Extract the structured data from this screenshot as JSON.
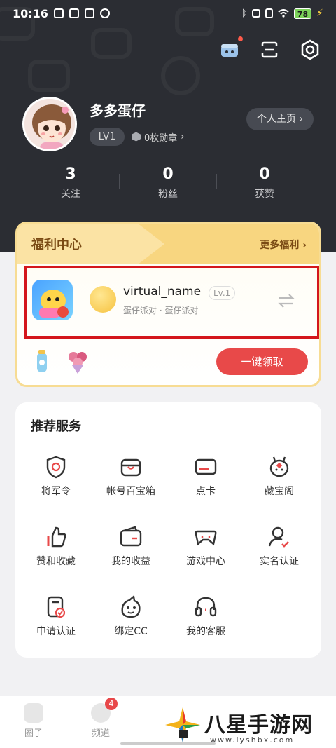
{
  "status_bar": {
    "time": "10:16",
    "battery": "78"
  },
  "profile": {
    "name": "多多蛋仔",
    "level": "LV1",
    "badges": "0枚勋章",
    "home_button": "个人主页"
  },
  "stats": [
    {
      "value": "3",
      "label": "关注"
    },
    {
      "value": "0",
      "label": "粉丝"
    },
    {
      "value": "0",
      "label": "获赞"
    }
  ],
  "welfare": {
    "title": "福利中心",
    "more": "更多福利",
    "account_name": "virtual_name",
    "account_level": "Lv.1",
    "account_sub": "蛋仔派对 · 蛋仔派对",
    "claim_button": "一键领取"
  },
  "services": {
    "title": "推荐服务",
    "items": [
      {
        "label": "将军令",
        "icon": "shield-token-icon"
      },
      {
        "label": "帐号百宝箱",
        "icon": "treasure-box-icon"
      },
      {
        "label": "点卡",
        "icon": "card-icon"
      },
      {
        "label": "藏宝阁",
        "icon": "treasure-pavilion-icon"
      },
      {
        "label": "赞和收藏",
        "icon": "thumbs-up-icon"
      },
      {
        "label": "我的收益",
        "icon": "wallet-icon"
      },
      {
        "label": "游戏中心",
        "icon": "gamepad-icon"
      },
      {
        "label": "实名认证",
        "icon": "user-verify-icon"
      },
      {
        "label": "申请认证",
        "icon": "apply-verify-icon"
      },
      {
        "label": "绑定CC",
        "icon": "cc-bind-icon"
      },
      {
        "label": "我的客服",
        "icon": "headset-icon"
      }
    ]
  },
  "tabbar": {
    "items": [
      {
        "label": "圈子"
      },
      {
        "label": "频道",
        "badge": "4"
      }
    ]
  },
  "watermark": {
    "title": "八星手游网",
    "url": "www.lyshbx.com"
  },
  "colors": {
    "accent": "#e84949",
    "highlight_border": "#d4161c",
    "dark_bg": "#2b2d33"
  }
}
